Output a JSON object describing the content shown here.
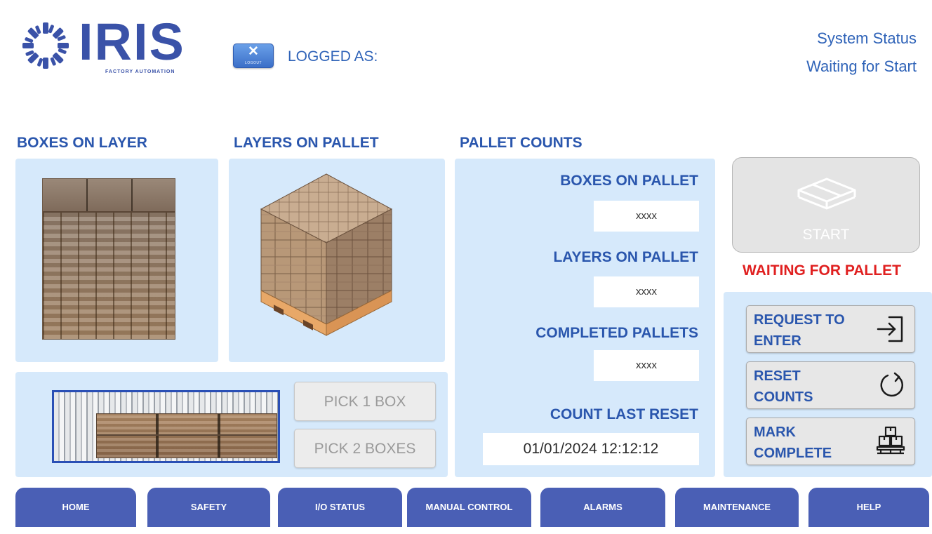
{
  "header": {
    "logo_text": "IRIS",
    "logo_subtitle": "FACTORY AUTOMATION",
    "logout_icon": "x-icon",
    "logout_label": "LOGOUT",
    "logged_as_label": "LOGGED AS:",
    "system_status_label": "System Status",
    "system_status_value": "Waiting for Start"
  },
  "sections": {
    "boxes_on_layer": "BOXES ON LAYER",
    "layers_on_pallet": "LAYERS ON PALLET",
    "pallet_counts": "PALLET COUNTS"
  },
  "pick": {
    "pick_one": "PICK 1 BOX",
    "pick_two": "PICK 2 BOXES"
  },
  "counts": {
    "boxes_on_pallet_label": "BOXES ON PALLET",
    "boxes_on_pallet_value": "xxxx",
    "layers_on_pallet_label": "LAYERS ON PALLET",
    "layers_on_pallet_value": "xxxx",
    "completed_pallets_label": "COMPLETED PALLETS",
    "completed_pallets_value": "xxxx",
    "count_last_reset_label": "COUNT LAST RESET",
    "count_last_reset_value": "01/01/2024 12:12:12"
  },
  "controls": {
    "start_label": "START",
    "waiting_status": "WAITING FOR PALLET",
    "request_enter_line1": "REQUEST TO",
    "request_enter_line2": "ENTER",
    "reset_counts_line1": "RESET",
    "reset_counts_line2": "COUNTS",
    "mark_complete_line1": "MARK",
    "mark_complete_line2": "COMPLETE"
  },
  "nav": {
    "home": "HOME",
    "safety": "SAFETY",
    "io_status": "I/O STATUS",
    "manual_control": "MANUAL CONTROL",
    "alarms": "ALARMS",
    "maintenance": "MAINTENANCE",
    "help": "HELP"
  },
  "colors": {
    "accent_blue": "#2a56ad",
    "panel_bg": "#d6e9fb",
    "nav_bg": "#4a5fb5",
    "alert_red": "#e02020"
  }
}
